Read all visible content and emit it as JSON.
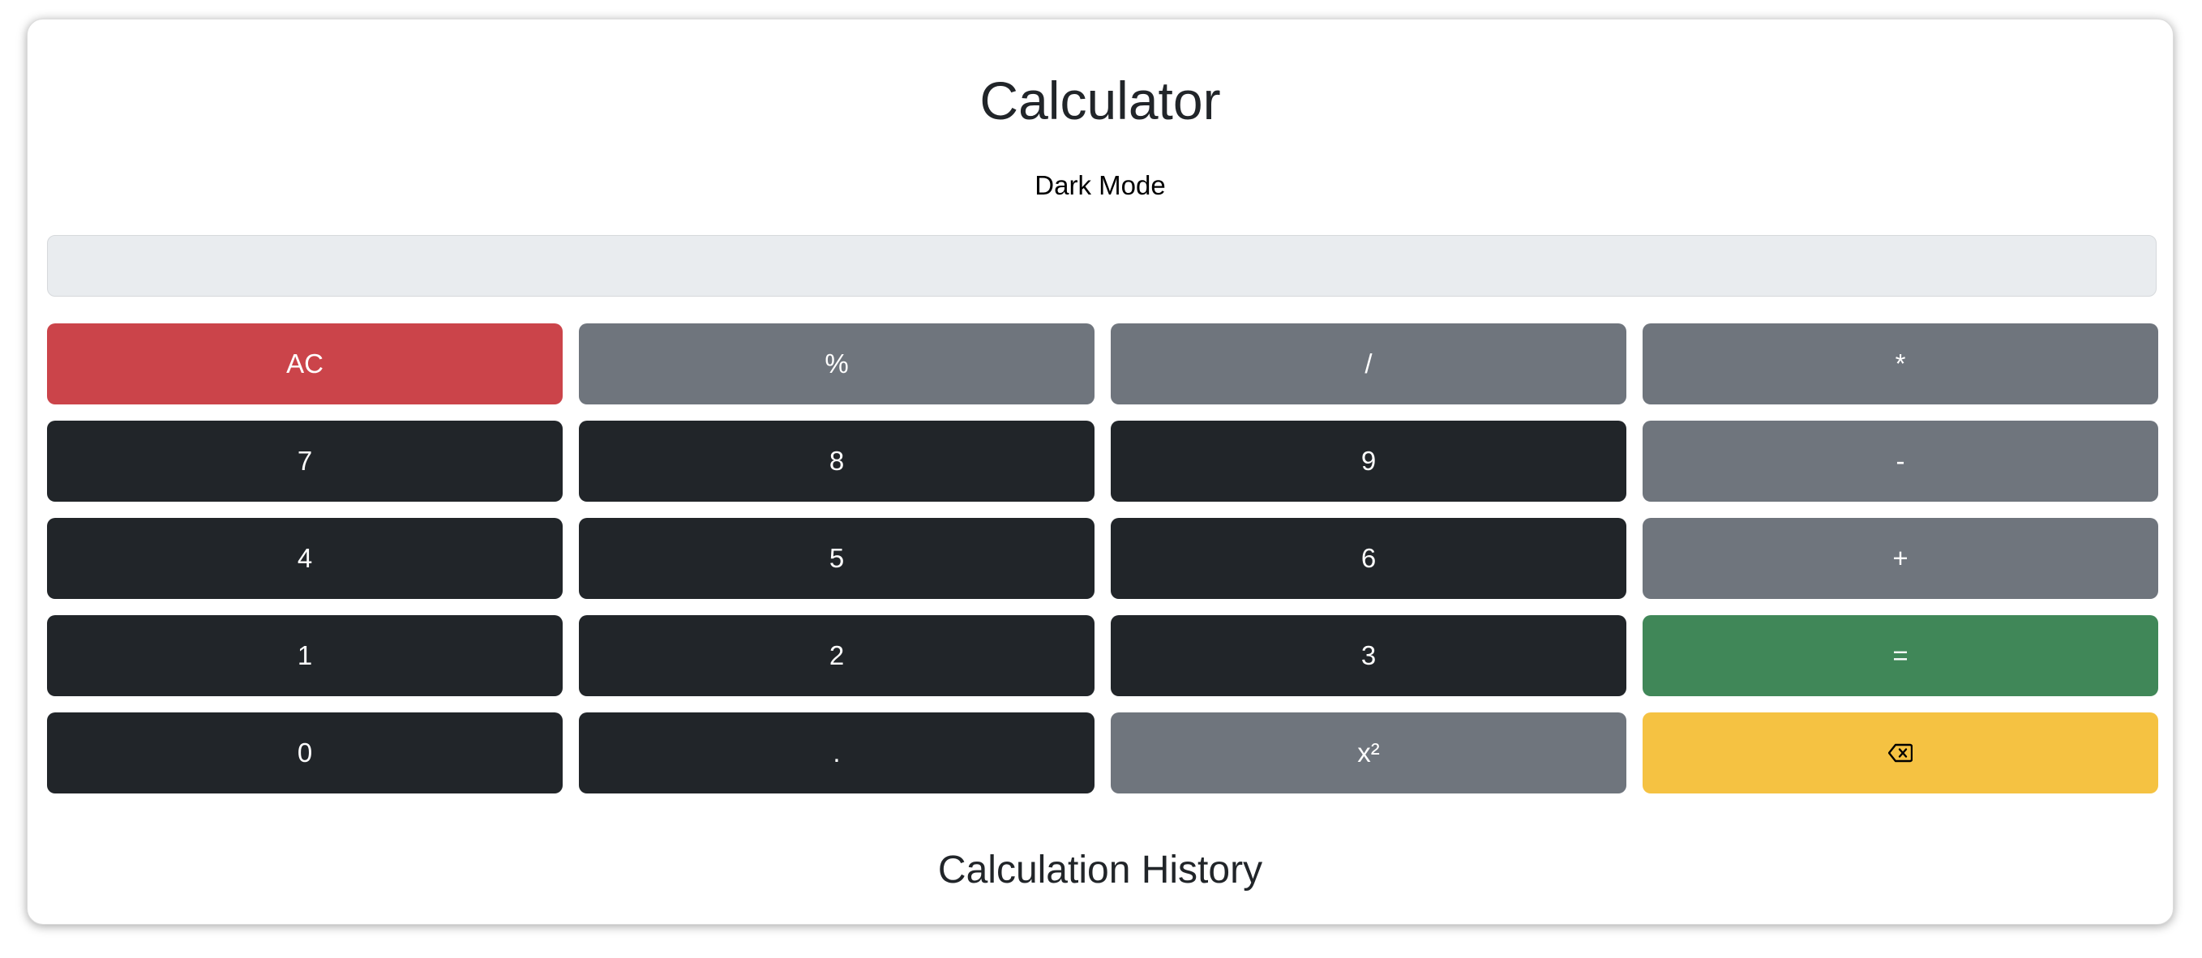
{
  "app": {
    "title": "Calculator",
    "mode_toggle_label": "Dark Mode",
    "history_title": "Calculation History"
  },
  "display": {
    "value": ""
  },
  "keys": [
    {
      "label": "AC",
      "variant": "danger"
    },
    {
      "label": "%",
      "variant": "secondary"
    },
    {
      "label": "/",
      "variant": "secondary"
    },
    {
      "label": "*",
      "variant": "secondary"
    },
    {
      "label": "7",
      "variant": "dark"
    },
    {
      "label": "8",
      "variant": "dark"
    },
    {
      "label": "9",
      "variant": "dark"
    },
    {
      "label": "-",
      "variant": "secondary"
    },
    {
      "label": "4",
      "variant": "dark"
    },
    {
      "label": "5",
      "variant": "dark"
    },
    {
      "label": "6",
      "variant": "dark"
    },
    {
      "label": "+",
      "variant": "secondary"
    },
    {
      "label": "1",
      "variant": "dark"
    },
    {
      "label": "2",
      "variant": "dark"
    },
    {
      "label": "3",
      "variant": "dark"
    },
    {
      "label": "=",
      "variant": "success"
    },
    {
      "label": "0",
      "variant": "dark"
    },
    {
      "label": ".",
      "variant": "dark"
    },
    {
      "label": "x²",
      "variant": "secondary"
    },
    {
      "icon": "backspace-icon",
      "variant": "warning"
    }
  ],
  "colors": {
    "danger": "#cb444a",
    "secondary": "#6f757d",
    "dark": "#212529",
    "success": "#408758",
    "warning": "#f5c242",
    "display_bg": "#e9ecef"
  }
}
